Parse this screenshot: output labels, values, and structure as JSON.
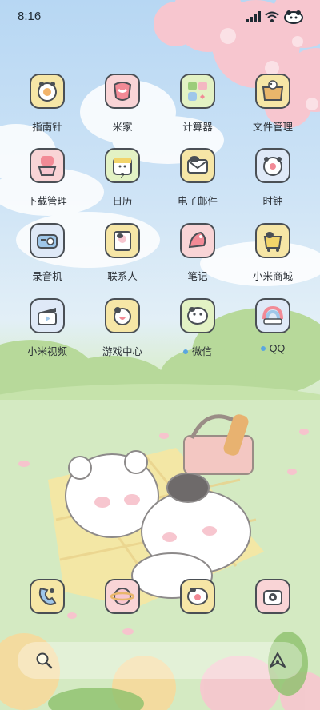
{
  "status_bar": {
    "time": "8:16",
    "icons": [
      "signal-icon",
      "wifi-icon",
      "battery-icon"
    ]
  },
  "apps": [
    {
      "label": "指南针",
      "icon": "compass-icon",
      "color": "#f6e6a6"
    },
    {
      "label": "米家",
      "icon": "mijia-icon",
      "color": "#f9d4d6"
    },
    {
      "label": "计算器",
      "icon": "calculator-icon",
      "color": "#e3f2c4"
    },
    {
      "label": "文件管理",
      "icon": "folder-icon",
      "color": "#f6e6a6"
    },
    {
      "label": "下载管理",
      "icon": "download-icon",
      "color": "#f9d4d6"
    },
    {
      "label": "日历",
      "icon": "calendar-icon",
      "badge": "2",
      "color": "#e3f2c4"
    },
    {
      "label": "电子邮件",
      "icon": "mail-icon",
      "color": "#f6e6a6"
    },
    {
      "label": "时钟",
      "icon": "clock-icon",
      "color": "#dfe9f7"
    },
    {
      "label": "录音机",
      "icon": "recorder-icon",
      "color": "#dfe9f7"
    },
    {
      "label": "联系人",
      "icon": "contacts-icon",
      "color": "#f6e6a6"
    },
    {
      "label": "笔记",
      "icon": "notes-icon",
      "color": "#f9d4d6"
    },
    {
      "label": "小米商城",
      "icon": "shop-icon",
      "color": "#f6e6a6"
    },
    {
      "label": "小米视频",
      "icon": "video-icon",
      "color": "#dfe9f7"
    },
    {
      "label": "游戏中心",
      "icon": "game-center-icon",
      "color": "#f6e6a6"
    },
    {
      "label": "微信",
      "icon": "wechat-icon",
      "color": "#e3f2c4",
      "dot": true
    },
    {
      "label": "QQ",
      "icon": "qq-icon",
      "color": "#dfe9f7",
      "dot": true
    }
  ],
  "dock": [
    {
      "icon": "phone-icon",
      "color": "#f6e6a6"
    },
    {
      "icon": "browser-icon",
      "color": "#f9d4d6"
    },
    {
      "icon": "messages-icon",
      "color": "#f6e6a6"
    },
    {
      "icon": "camera-icon",
      "color": "#f9d4d6"
    }
  ],
  "search_bar": {
    "left_icon": "search-icon",
    "right_icon": "assistant-icon"
  }
}
